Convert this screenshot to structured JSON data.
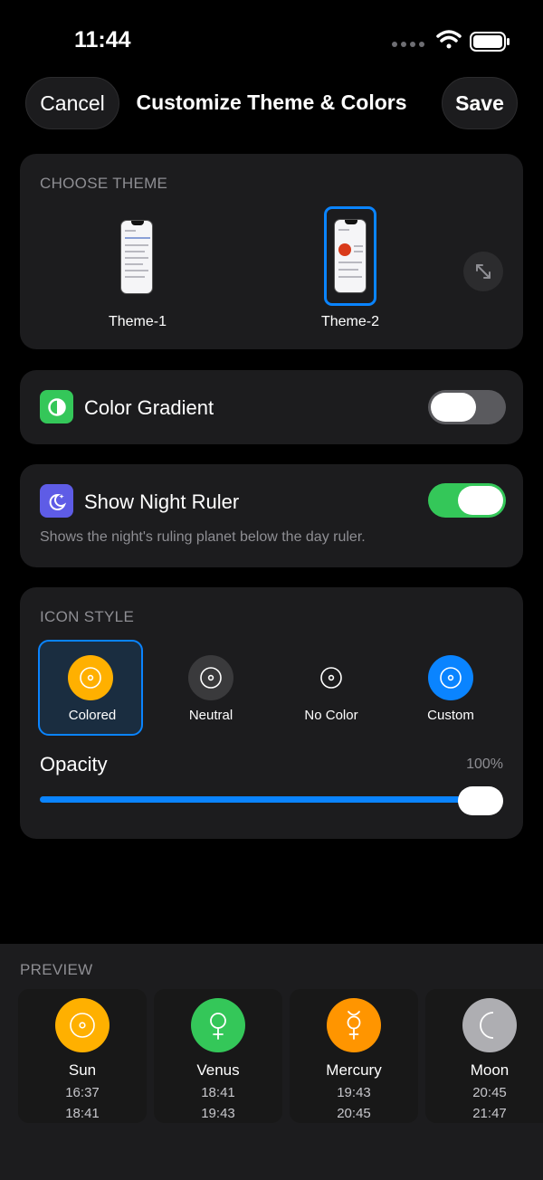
{
  "status_bar": {
    "time": "11:44"
  },
  "nav": {
    "cancel_label": "Cancel",
    "title": "Customize Theme & Colors",
    "save_label": "Save"
  },
  "theme_section": {
    "label": "CHOOSE THEME",
    "themes": [
      {
        "name": "Theme-1",
        "selected": false
      },
      {
        "name": "Theme-2",
        "selected": true
      }
    ]
  },
  "color_gradient": {
    "label": "Color Gradient",
    "enabled": false,
    "icon": "half-circle-icon"
  },
  "night_ruler": {
    "label": "Show Night Ruler",
    "enabled": true,
    "description": "Shows the night's ruling planet below the day ruler.",
    "icon": "moon-stars-icon"
  },
  "icon_style": {
    "label": "ICON STYLE",
    "options": [
      {
        "name": "Colored",
        "selected": true,
        "color": "#ffb000"
      },
      {
        "name": "Neutral",
        "selected": false,
        "color": "#3a3a3c"
      },
      {
        "name": "No Color",
        "selected": false,
        "color": "transparent"
      },
      {
        "name": "Custom",
        "selected": false,
        "color": "#0a84ff"
      }
    ],
    "opacity_label": "Opacity",
    "opacity_value": "100%"
  },
  "preview": {
    "label": "PREVIEW",
    "planets": [
      {
        "name": "Sun",
        "symbol": "☉",
        "color": "#ffb000",
        "time1": "16:37",
        "time2": "18:41"
      },
      {
        "name": "Venus",
        "symbol": "♀",
        "color": "#34c759",
        "time1": "18:41",
        "time2": "19:43"
      },
      {
        "name": "Mercury",
        "symbol": "☿",
        "color": "#ff9500",
        "time1": "19:43",
        "time2": "20:45"
      },
      {
        "name": "Moon",
        "symbol": "☾",
        "color": "#aeaeb2",
        "time1": "20:45",
        "time2": "21:47"
      }
    ]
  },
  "colors": {
    "accent": "#0a84ff",
    "toggle_on": "#34c759",
    "card": "#1c1c1e"
  }
}
